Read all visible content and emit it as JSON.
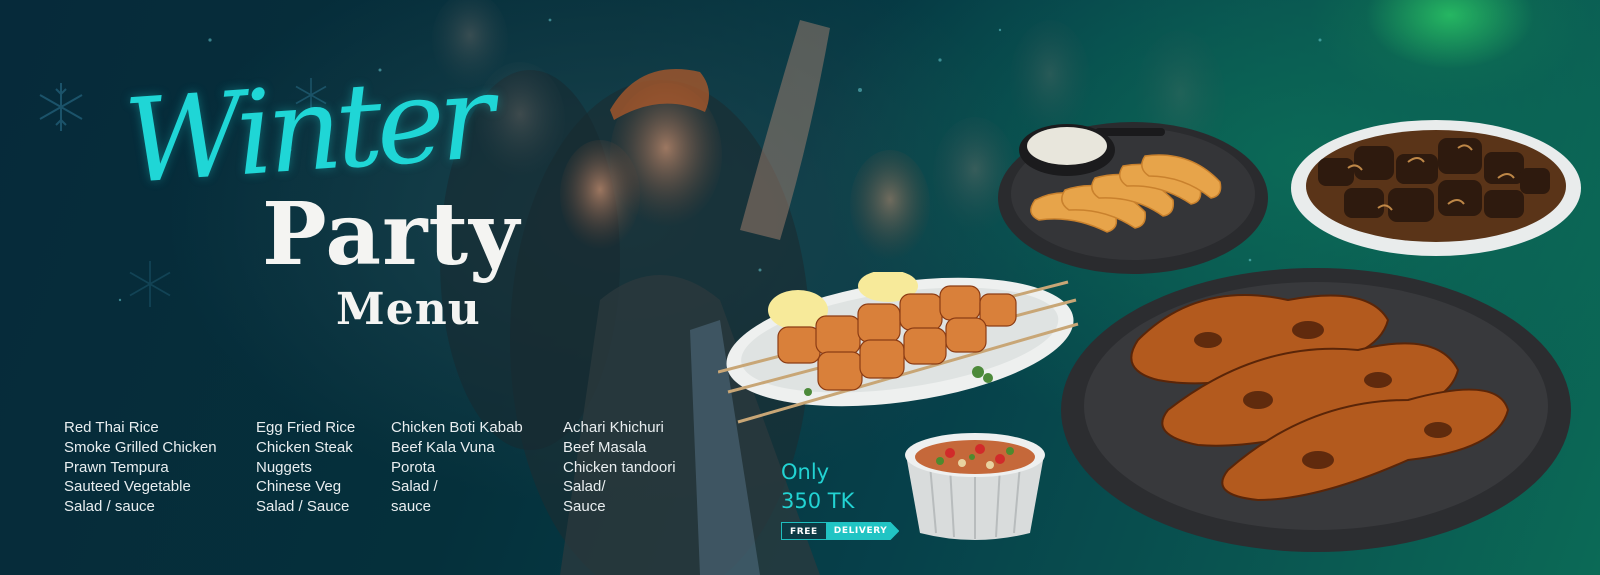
{
  "title": {
    "script": "Winter",
    "main": "Party",
    "sub": "Menu"
  },
  "menu_columns": [
    [
      "Red Thai Rice",
      "Smoke Grilled Chicken",
      "Prawn Tempura",
      "Sauteed Vegetable",
      "Salad / sauce"
    ],
    [
      "Egg Fried Rice",
      "Chicken Steak",
      "Nuggets",
      "Chinese Veg",
      "Salad / Sauce"
    ],
    [
      "Chicken Boti Kabab",
      "Beef Kala Vuna",
      "Porota",
      "Salad /",
      "sauce"
    ],
    [
      "Achari Khichuri",
      "Beef Masala",
      "Chicken tandoori",
      "Salad/",
      "Sauce"
    ]
  ],
  "price": {
    "prefix": "Only",
    "amount": "350 TK"
  },
  "delivery_badge": {
    "free": "FREE",
    "delivery": "DELIVERY"
  },
  "colors": {
    "accent": "#21c4c4",
    "glow": "#3cff6e",
    "background": "#05303b"
  },
  "dishes": [
    "prawn-tempura-plate",
    "beef-masala-plate",
    "chicken-boti-kabab-plate",
    "chicken-tandoori-plate",
    "salad-bowl"
  ],
  "decorations": [
    "snowflake-icon",
    "snowflake-icon",
    "snowflake-icon"
  ]
}
